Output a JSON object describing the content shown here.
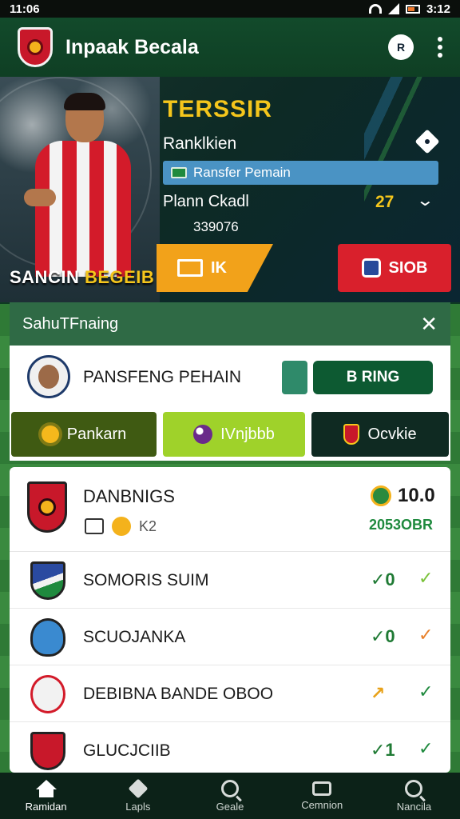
{
  "status_bar": {
    "time": "11:06",
    "battery": "3:12"
  },
  "header": {
    "title": "Inpaak Becala",
    "action_badge": "R"
  },
  "hero": {
    "player_name_part1": "SANCIN ",
    "player_name_part2": "BEGEIB",
    "title": "TERSSIR",
    "rank_label": "Ranklkien",
    "bar_label": "Ransfer Pemain",
    "row_label": "Plann Ckadl",
    "row_value": "27",
    "sub_value": "339076",
    "btn_yellow_label": "IK",
    "btn_red_label": "SIOB"
  },
  "transfer_panel": {
    "title": "SahuTFnaing",
    "search_label": "PANSFENG PEHAIN",
    "toggle_label": "B RING",
    "tabs": [
      {
        "label": "Pankarn"
      },
      {
        "label": "IVnjbbb"
      },
      {
        "label": "Ocvkie"
      }
    ]
  },
  "standings": {
    "top": {
      "name": "DANBNIGS",
      "meta": "K2",
      "score": "10.0",
      "sub": "2053OBR"
    },
    "rows": [
      {
        "name": "SOMORIS SUIM",
        "value": "✓0",
        "chev_color": "#7ac23a"
      },
      {
        "name": "SCUOJANKA",
        "value": "✓0",
        "chev_color": "#e8802a"
      },
      {
        "name": "DEBIBNA BANDE OBOO",
        "value": "↗",
        "chev_color": "#1f8a3e"
      },
      {
        "name": "GLUCJCIIB",
        "value": "✓1",
        "chev_color": "#1f8a3e"
      }
    ]
  },
  "bottom_nav": [
    {
      "label": "Ramidan"
    },
    {
      "label": "Lapls"
    },
    {
      "label": "Geale"
    },
    {
      "label": "Cemnion"
    },
    {
      "label": "Nancila"
    }
  ],
  "colors": {
    "accent_yellow": "#f5c61c",
    "brand_green": "#124a2b",
    "danger_red": "#d9202c"
  }
}
